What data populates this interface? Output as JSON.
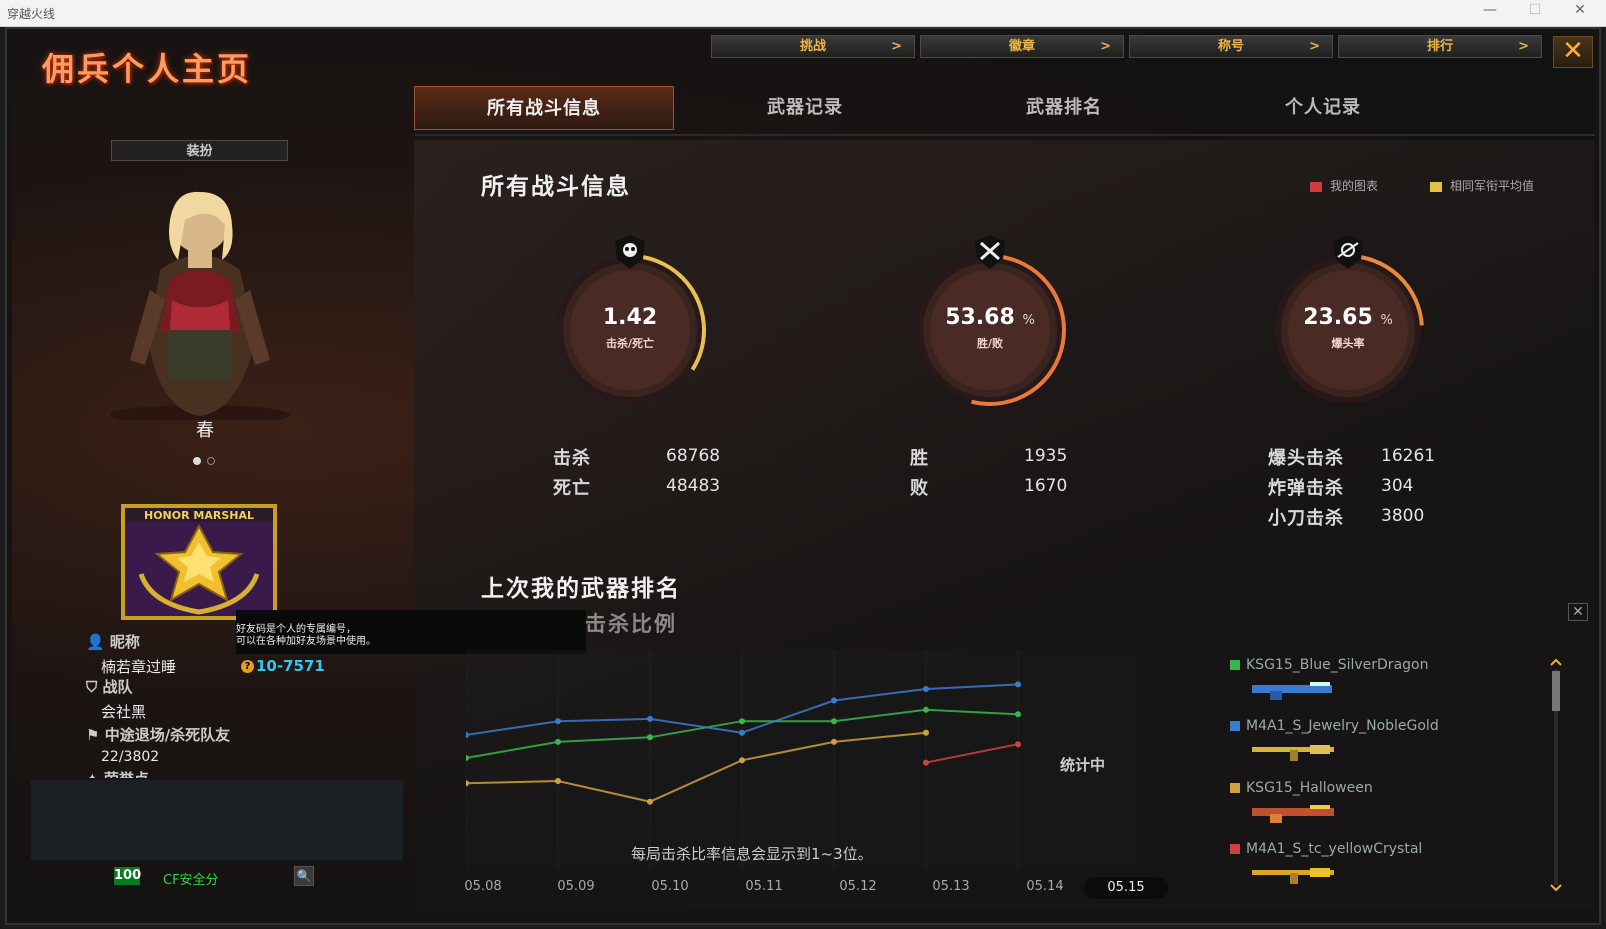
{
  "window": {
    "title": "穿越火线"
  },
  "page_title": "佣兵个人主页",
  "top_tabs": [
    {
      "label": "挑战",
      "arrow": ">"
    },
    {
      "label": "徽章",
      "arrow": ">"
    },
    {
      "label": "称号",
      "arrow": ">"
    },
    {
      "label": "排行",
      "arrow": ">"
    }
  ],
  "close_label": "✕",
  "tabs": [
    "所有战斗信息",
    "武器记录",
    "武器排名",
    "个人记录"
  ],
  "left": {
    "outfit_label": "装扮",
    "character_name": "春",
    "emblem_text": "HONOR MARSHAL",
    "tooltip_line1": "好友码是个人的专属编号，",
    "tooltip_line2": "可以在各种加好友场景中使用。",
    "nickname_label": "昵称",
    "nickname": "楠若章过睡",
    "friend_code_q": "?",
    "friend_code": "10-7571",
    "team_label": "战队",
    "team": "会社黑",
    "quit_label": "中途退场/杀死队友",
    "quit_value": "22/3802",
    "honor_label": "荣誉点",
    "score": "100",
    "cf_label": "CF安全分",
    "search_icon": "🔍"
  },
  "stats": {
    "title": "所有战斗信息",
    "legend": [
      {
        "label": "我的图表",
        "color": "#d03b3b"
      },
      {
        "label": "相同军衔平均值",
        "color": "#e8c040"
      }
    ],
    "gauges": [
      {
        "value": "1.42",
        "pct": "",
        "label": "击杀/死亡",
        "icon": "skull-icon",
        "fraction": 0.34
      },
      {
        "value": "53.68",
        "pct": "%",
        "label": "胜/败",
        "icon": "crossed-guns-icon",
        "fraction": 0.54
      },
      {
        "value": "23.65",
        "pct": "%",
        "label": "爆头率",
        "icon": "headshot-icon",
        "fraction": 0.24
      }
    ],
    "kill_label": "击杀",
    "kill_value": "68768",
    "death_label": "死亡",
    "death_value": "48483",
    "win_label": "胜",
    "win_value": "1935",
    "lose_label": "败",
    "lose_value": "1670",
    "headshot_label": "爆头击杀",
    "headshot_value": "16261",
    "bomb_label": "炸弹击杀",
    "bomb_value": "304",
    "knife_label": "小刀击杀",
    "knife_value": "3800"
  },
  "weapon_rank": {
    "title": "上次我的武器排名",
    "subtitle": "击杀比例",
    "counting": "统计中",
    "note": "每局击杀比率信息会显示到1~3位。",
    "dates": [
      "05.08",
      "05.09",
      "05.10",
      "05.11",
      "05.12",
      "05.13",
      "05.14",
      "05.15"
    ],
    "close": "✕",
    "weapons": [
      {
        "name": "KSG15_Blue_SilverDragon",
        "color": "#3cb64a"
      },
      {
        "name": "M4A1_S_Jewelry_NobleGold",
        "color": "#3a7bd0"
      },
      {
        "name": "KSG15_Halloween",
        "color": "#d0a040"
      },
      {
        "name": "M4A1_S_tc_yellowCrystal",
        "color": "#d04040"
      }
    ]
  },
  "chart_data": {
    "type": "line",
    "categories": [
      "05.08",
      "05.09",
      "05.10",
      "05.11",
      "05.12",
      "05.13",
      "05.14"
    ],
    "series": [
      {
        "name": "KSG15_Blue_SilverDragon",
        "color": "#3cb64a",
        "values": [
          0.4,
          0.47,
          0.49,
          0.56,
          0.56,
          0.61,
          0.59
        ]
      },
      {
        "name": "M4A1_S_Jewelry_NobleGold",
        "color": "#3a7bd0",
        "values": [
          0.5,
          0.56,
          0.57,
          0.51,
          0.65,
          0.7,
          0.72
        ]
      },
      {
        "name": "KSG15_Halloween",
        "color": "#d0a040",
        "values": [
          0.29,
          0.3,
          0.21,
          0.39,
          0.47,
          0.51,
          null
        ]
      },
      {
        "name": "M4A1_S_tc_yellowCrystal",
        "color": "#d04040",
        "values": [
          null,
          null,
          null,
          null,
          null,
          0.38,
          0.46
        ]
      }
    ],
    "ylim": [
      0,
      1
    ]
  }
}
